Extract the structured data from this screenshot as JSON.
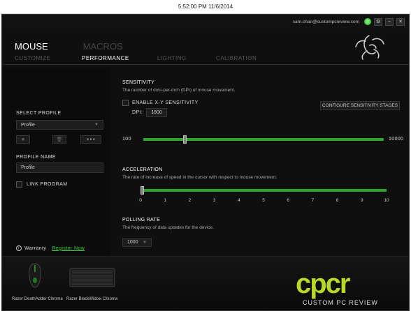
{
  "taskbar": {
    "clock": "5:52:00 PM 11/6/2014"
  },
  "header": {
    "email": "sam.chan@custompcreview.com",
    "gear": "⚙",
    "minimize": "−",
    "close": "✕"
  },
  "nav": {
    "tabs": [
      "MOUSE",
      "MACROS"
    ],
    "subtabs": [
      "CUSTOMIZE",
      "PERFORMANCE",
      "LIGHTING",
      "CALIBRATION"
    ]
  },
  "left": {
    "select_profile_label": "SELECT PROFILE",
    "profile_value": "Profile",
    "add_label": "+",
    "delete_label": "🗑",
    "more_label": "• • •",
    "profile_name_label": "PROFILE NAME",
    "profile_name_value": "Profile",
    "link_program_label": "LINK PROGRAM",
    "warranty_label": "Warranty",
    "register_label": "Register Now"
  },
  "sensitivity": {
    "title": "SENSITIVITY",
    "desc": "The number of dots-per-inch (DPI) of mouse movement.",
    "xy_label": "ENABLE X-Y SENSITIVITY",
    "dpi_label": "DPI:",
    "dpi_value": "1800",
    "configure_label": "CONFIGURE SENSITIVITY STAGES",
    "min": "100",
    "max": "10000",
    "level": 1800
  },
  "acceleration": {
    "title": "ACCELERATION",
    "desc": "The rate of increase of speed in the cursor with respect to mouse movement.",
    "ticks": [
      "0",
      "1",
      "2",
      "3",
      "4",
      "5",
      "6",
      "7",
      "8",
      "9",
      "10"
    ],
    "level": 0
  },
  "polling": {
    "title": "POLLING RATE",
    "desc": "The frequency of data updates for the device.",
    "value": "1000"
  },
  "devices": [
    "Razer DeathAdder Chroma",
    "Razer BlackWidow Chroma"
  ],
  "watermark": {
    "logo": "cpcr",
    "text": "CUSTOM PC REVIEW"
  },
  "colors": {
    "accent": "#2da22d",
    "link": "#3cd23c",
    "watermark": "#b8d82a"
  }
}
